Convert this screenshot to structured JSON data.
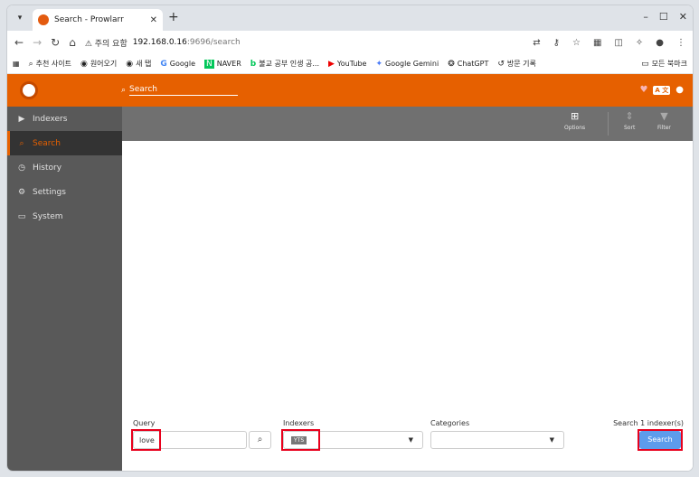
{
  "browser": {
    "tab_title": "Search - Prowlarr",
    "security_label": "⚠ 주의 요함",
    "url_host": "192.168.0.16",
    "url_path": ":9696/search",
    "bookmarks": [
      {
        "icon": "search-icon",
        "label": "추천 사이트"
      },
      {
        "icon": "globe-icon",
        "label": "원어오기"
      },
      {
        "icon": "globe-icon",
        "label": "새 탭"
      },
      {
        "icon": "google-icon",
        "label": "Google"
      },
      {
        "icon": "naver-icon",
        "label": "NAVER"
      },
      {
        "icon": "blog-icon",
        "label": "불교 공부 인생 공..."
      },
      {
        "icon": "youtube-icon",
        "label": "YouTube"
      },
      {
        "icon": "gemini-icon",
        "label": "Google Gemini"
      },
      {
        "icon": "chatgpt-icon",
        "label": "ChatGPT"
      },
      {
        "icon": "history-icon",
        "label": "방문 기록"
      }
    ],
    "all_bookmarks": "모든 북마크"
  },
  "header": {
    "search_label": "Search"
  },
  "sidebar": {
    "items": [
      {
        "label": "Indexers",
        "icon": "play-icon"
      },
      {
        "label": "Search",
        "icon": "search-icon"
      },
      {
        "label": "History",
        "icon": "clock-icon"
      },
      {
        "label": "Settings",
        "icon": "gears-icon"
      },
      {
        "label": "System",
        "icon": "laptop-icon"
      }
    ]
  },
  "toolbar": {
    "options_label": "Options",
    "sort_label": "Sort",
    "filter_label": "Filter"
  },
  "form": {
    "query_label": "Query",
    "query_value": "love",
    "indexers_label": "Indexers",
    "indexer_tag": "YTS",
    "categories_label": "Categories",
    "search_count_label": "Search 1 indexer(s)",
    "search_button": "Search"
  },
  "colors": {
    "accent": "#e66000",
    "sidebar": "#595959",
    "button": "#5d9cec",
    "highlight": "#e8001c"
  }
}
